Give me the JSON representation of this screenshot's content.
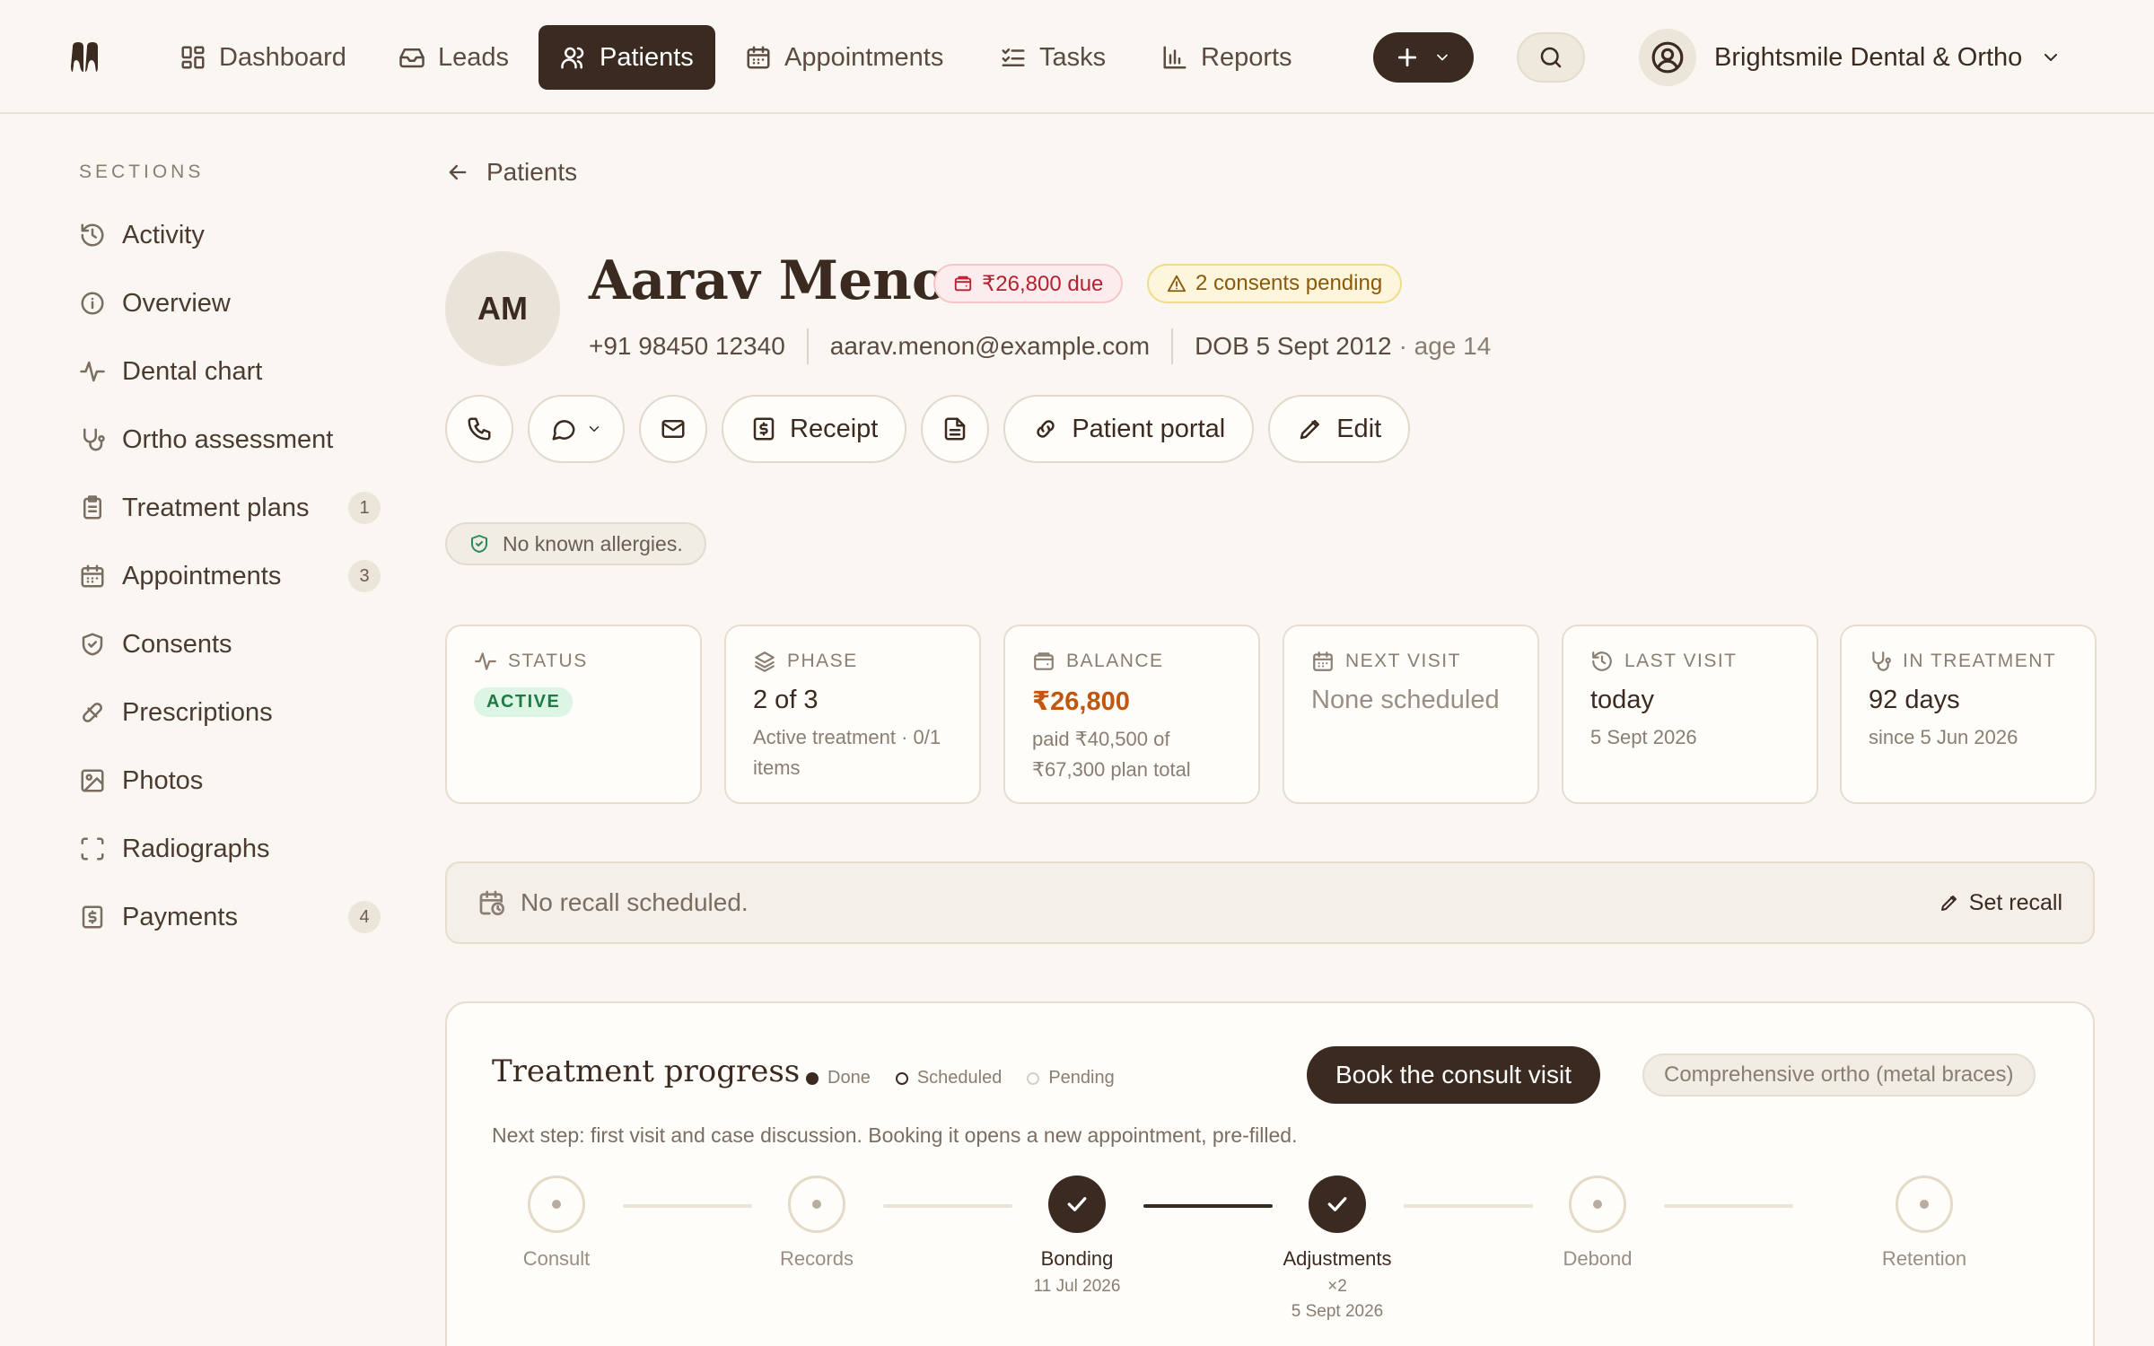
{
  "nav": {
    "items": [
      {
        "label": "Dashboard",
        "icon": "dashboard-icon"
      },
      {
        "label": "Leads",
        "icon": "inbox-icon"
      },
      {
        "label": "Patients",
        "icon": "users-icon",
        "active": true
      },
      {
        "label": "Appointments",
        "icon": "calendar-icon"
      },
      {
        "label": "Tasks",
        "icon": "checklist-icon"
      },
      {
        "label": "Reports",
        "icon": "bar-chart-icon"
      }
    ],
    "org_name": "Brightsmile Dental & Ortho"
  },
  "sidebar": {
    "heading": "SECTIONS",
    "items": [
      {
        "label": "Activity",
        "icon": "history-icon",
        "count": ""
      },
      {
        "label": "Overview",
        "icon": "info-icon",
        "count": ""
      },
      {
        "label": "Dental chart",
        "icon": "pulse-icon",
        "count": ""
      },
      {
        "label": "Ortho assessment",
        "icon": "stethoscope-icon",
        "count": ""
      },
      {
        "label": "Treatment plans",
        "icon": "clipboard-icon",
        "count": "1"
      },
      {
        "label": "Appointments",
        "icon": "calendar-icon",
        "count": "3"
      },
      {
        "label": "Consents",
        "icon": "shield-check-icon",
        "count": ""
      },
      {
        "label": "Prescriptions",
        "icon": "pill-icon",
        "count": ""
      },
      {
        "label": "Photos",
        "icon": "image-icon",
        "count": ""
      },
      {
        "label": "Radiographs",
        "icon": "scan-icon",
        "count": ""
      },
      {
        "label": "Payments",
        "icon": "receipt-icon",
        "count": "4"
      }
    ]
  },
  "patient": {
    "back_label": "Patients",
    "initials": "AM",
    "name": "Aarav Menon",
    "due_badge": "₹26,800 due",
    "consent_badge": "2 consents pending",
    "phone": "+91 98450 12340",
    "email": "aarav.menon@example.com",
    "dob": "DOB 5 Sept 2012",
    "age": "· age 14",
    "allergy": "No known allergies."
  },
  "actions": {
    "receipt": "Receipt",
    "portal": "Patient portal",
    "edit": "Edit"
  },
  "stats": [
    {
      "label": "STATUS",
      "icon": "pulse-icon",
      "pill": "ACTIVE"
    },
    {
      "label": "PHASE",
      "icon": "layers-icon",
      "value": "2 of 3",
      "sub": "Active treatment · 0/1 items"
    },
    {
      "label": "BALANCE",
      "icon": "wallet-icon",
      "value": "₹26,800",
      "sub": "paid ₹40,500 of ₹67,300 plan total"
    },
    {
      "label": "NEXT VISIT",
      "icon": "calendar-icon",
      "value": "None scheduled"
    },
    {
      "label": "LAST VISIT",
      "icon": "history-icon",
      "value": "today",
      "sub": "5 Sept 2026"
    },
    {
      "label": "IN TREATMENT",
      "icon": "stethoscope-icon",
      "value": "92 days",
      "sub": "since 5 Jun 2026"
    }
  ],
  "recall": {
    "text": "No recall scheduled.",
    "action": "Set recall"
  },
  "progress": {
    "title": "Treatment progress",
    "legend": {
      "done": "Done",
      "scheduled": "Scheduled",
      "pending": "Pending"
    },
    "book_label": "Book the consult visit",
    "plan": "Comprehensive ortho (metal braces)",
    "next_step": "Next step: first visit and case discussion. Booking it opens a new appointment, pre-filled.",
    "steps": [
      {
        "name": "Consult",
        "state": "pending",
        "meta1": "",
        "meta2": ""
      },
      {
        "name": "Records",
        "state": "pending",
        "meta1": "",
        "meta2": ""
      },
      {
        "name": "Bonding",
        "state": "done",
        "meta1": "11 Jul 2026",
        "meta2": ""
      },
      {
        "name": "Adjustments",
        "state": "done",
        "meta1": "×2",
        "meta2": "5 Sept 2026"
      },
      {
        "name": "Debond",
        "state": "pending",
        "meta1": "",
        "meta2": ""
      },
      {
        "name": "Retention",
        "state": "pending",
        "meta1": "",
        "meta2": ""
      }
    ]
  }
}
